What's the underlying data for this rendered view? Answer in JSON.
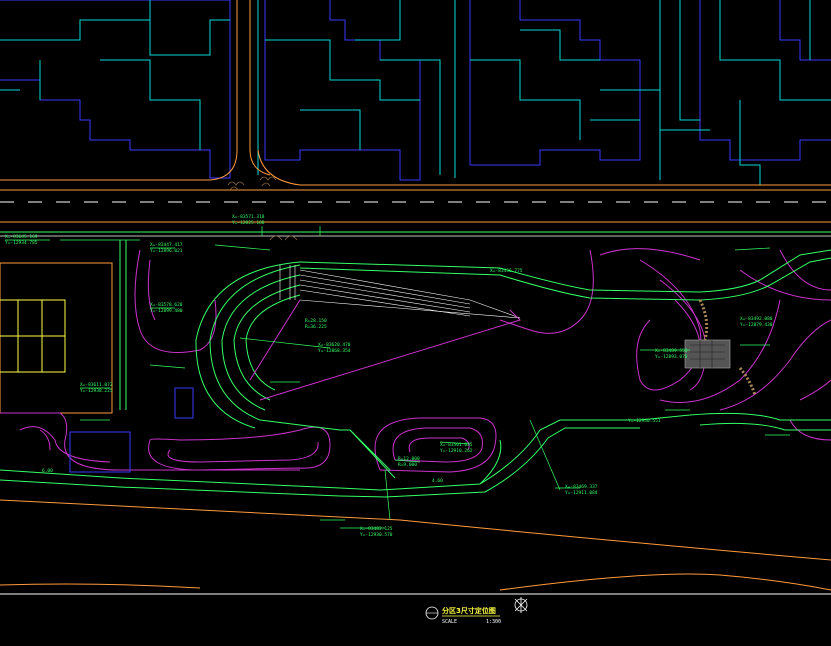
{
  "drawing": {
    "title": "分区3尺寸定位图",
    "scale_label": "SCALE",
    "scale_value": "1:300"
  },
  "colors": {
    "background": "#000000",
    "building_outline": "#3a3aff",
    "building_inner": "#00d8d8",
    "road_edge": "#ff9a3c",
    "path_green": "#33ff66",
    "contour_magenta": "#cc33cc",
    "dimension_white": "#ffffff",
    "title_yellow": "#ffff44"
  },
  "annotations": [
    "X=-83645.169",
    "Y=-12934.785",
    "X=-83447.417",
    "Y=-12896.021",
    "X=-83571.318",
    "Y=-12825.188",
    "R=28.150",
    "R=36.225",
    "X=-83620.470",
    "Y=-12868.354",
    "X=-83611.072",
    "Y=-12938.225",
    "X=-83578.620",
    "Y=-12899.480",
    "X=-83501.055",
    "Y=-12910.262",
    "R=12.000",
    "R=9.000",
    "X=-83489.553",
    "Y=-12893.070",
    "X=-83492.080",
    "Y=-12879.430",
    "X=-83469.337",
    "Y=-12911.084",
    "X=-83482.125",
    "Y=-12930.570",
    "X=-83436.775",
    "Y=-12940.551",
    "4.60",
    "6.00",
    "14.61",
    "1.50"
  ]
}
